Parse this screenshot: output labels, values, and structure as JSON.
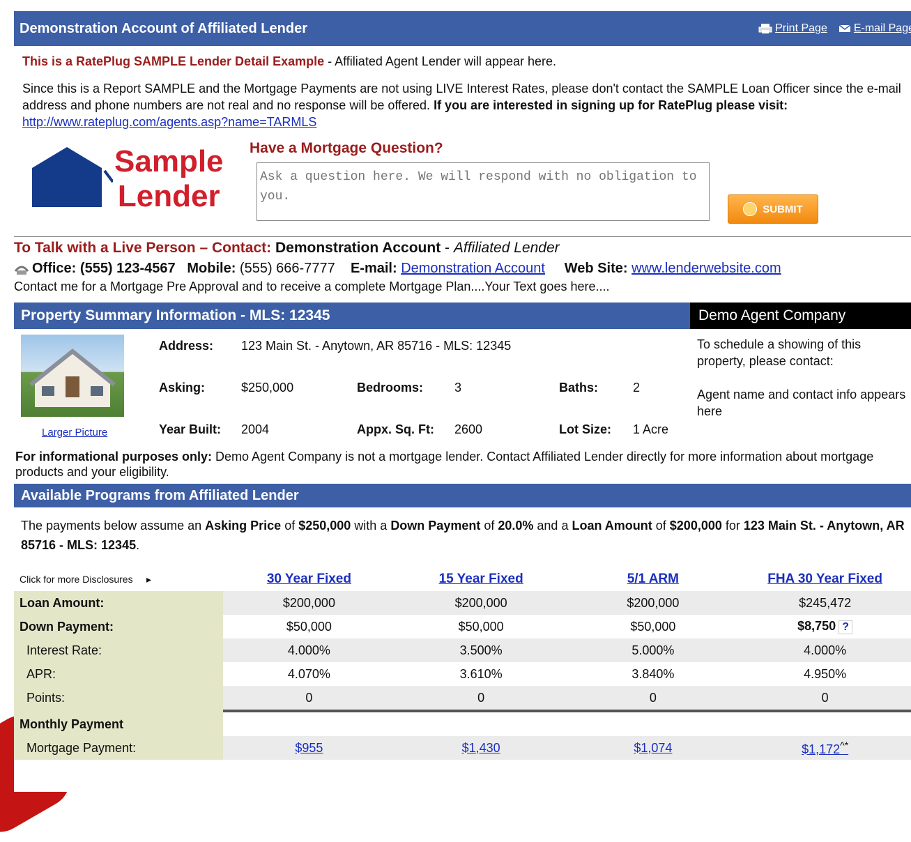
{
  "header": {
    "title": "Demonstration Account of Affiliated Lender",
    "print_label": "Print Page",
    "email_label": "E-mail Page"
  },
  "sample": {
    "lead": "This is a RatePlug SAMPLE Lender Detail Example",
    "rest": " - Affiliated Agent Lender will appear here.",
    "notice_text": "Since this is a Report SAMPLE and the Mortgage Payments are not using LIVE Interest Rates, please don't contact the SAMPLE Loan Officer since the e-mail address and phone numbers are not real and no response will be offered. ",
    "notice_bold": "If you are interested in signing up for RatePlug please visit: ",
    "signup_url": "http://www.rateplug.com/agents.asp?name=TARMLS"
  },
  "logo": {
    "line1": "Sample",
    "line2": "Lender"
  },
  "question": {
    "title": "Have a Mortgage Question?",
    "placeholder": "Ask a question here. We will respond with no obligation to you.",
    "submit_label": "SUBMIT"
  },
  "contact": {
    "talk_label": "To Talk with a Live Person – Contact:",
    "name": "Demonstration Account",
    "company": "Affiliated Lender",
    "office_label": "Office:",
    "office_phone": "(555) 123-4567",
    "mobile_label": "Mobile:",
    "mobile_phone": "(555) 666-7777",
    "email_label": "E-mail:",
    "email_link": "Demonstration Account",
    "web_label": "Web Site:",
    "web_link": "www.lenderwebsite.com",
    "blurb": "Contact me for a Mortgage Pre Approval and to receive a complete Mortgage Plan....Your Text goes here...."
  },
  "property": {
    "bar_title": "Property Summary Information - MLS: 12345",
    "agent_company": "Demo Agent Company",
    "larger_picture": "Larger Picture",
    "address_label": "Address:",
    "address": "123 Main St. - Anytown, AR 85716 - MLS: 12345",
    "asking_label": "Asking:",
    "asking": "$250,000",
    "bedrooms_label": "Bedrooms:",
    "bedrooms": "3",
    "baths_label": "Baths:",
    "baths": "2",
    "year_label": "Year Built:",
    "year": "2004",
    "sqft_label": "Appx. Sq. Ft:",
    "sqft": "2600",
    "lot_label": "Lot Size:",
    "lot": "1 Acre",
    "schedule_text": "To schedule a showing of this property, please contact:",
    "agent_info": "Agent name and contact info appears here"
  },
  "info_note": {
    "bold": "For informational purposes only:",
    "text": " Demo Agent Company is not a mortgage lender. Contact Affiliated Lender directly for more information about mortgage products and your eligibility."
  },
  "programs": {
    "bar_title": "Available Programs from Affiliated Lender",
    "assume": {
      "t1": "The payments below assume an ",
      "b1": "Asking Price",
      "t2": " of ",
      "b2": "$250,000",
      "t3": " with a ",
      "b3": "Down Payment",
      "t4": " of ",
      "b4": "20.0%",
      "t5": " and a ",
      "b5": "Loan Amount",
      "t6": " of ",
      "b6": "$200,000",
      "t7": " for ",
      "b7": "123 Main St. - Anytown, AR 85716 - MLS: 12345",
      "t8": "."
    },
    "disclosures_label": "Click for more Disclosures",
    "columns": [
      "30 Year Fixed",
      "15 Year Fixed",
      "5/1 ARM",
      "FHA 30 Year Fixed"
    ],
    "rows": {
      "loan_amount": {
        "label": "Loan Amount:",
        "values": [
          "$200,000",
          "$200,000",
          "$200,000",
          "$245,472"
        ]
      },
      "down_payment": {
        "label": "Down Payment:",
        "values": [
          "$50,000",
          "$50,000",
          "$50,000",
          "$8,750"
        ]
      },
      "interest_rate": {
        "label": "Interest Rate:",
        "values": [
          "4.000%",
          "3.500%",
          "5.000%",
          "4.000%"
        ]
      },
      "apr": {
        "label": "APR:",
        "values": [
          "4.070%",
          "3.610%",
          "3.840%",
          "4.950%"
        ]
      },
      "points": {
        "label": "Points:",
        "values": [
          "0",
          "0",
          "0",
          "0"
        ]
      }
    },
    "monthly_label": "Monthly Payment",
    "mortgage_payment": {
      "label": "Mortgage Payment:",
      "values": [
        "$955",
        "$1,430",
        "$1,074",
        "$1,172"
      ],
      "fha_suffix": "^*"
    }
  }
}
